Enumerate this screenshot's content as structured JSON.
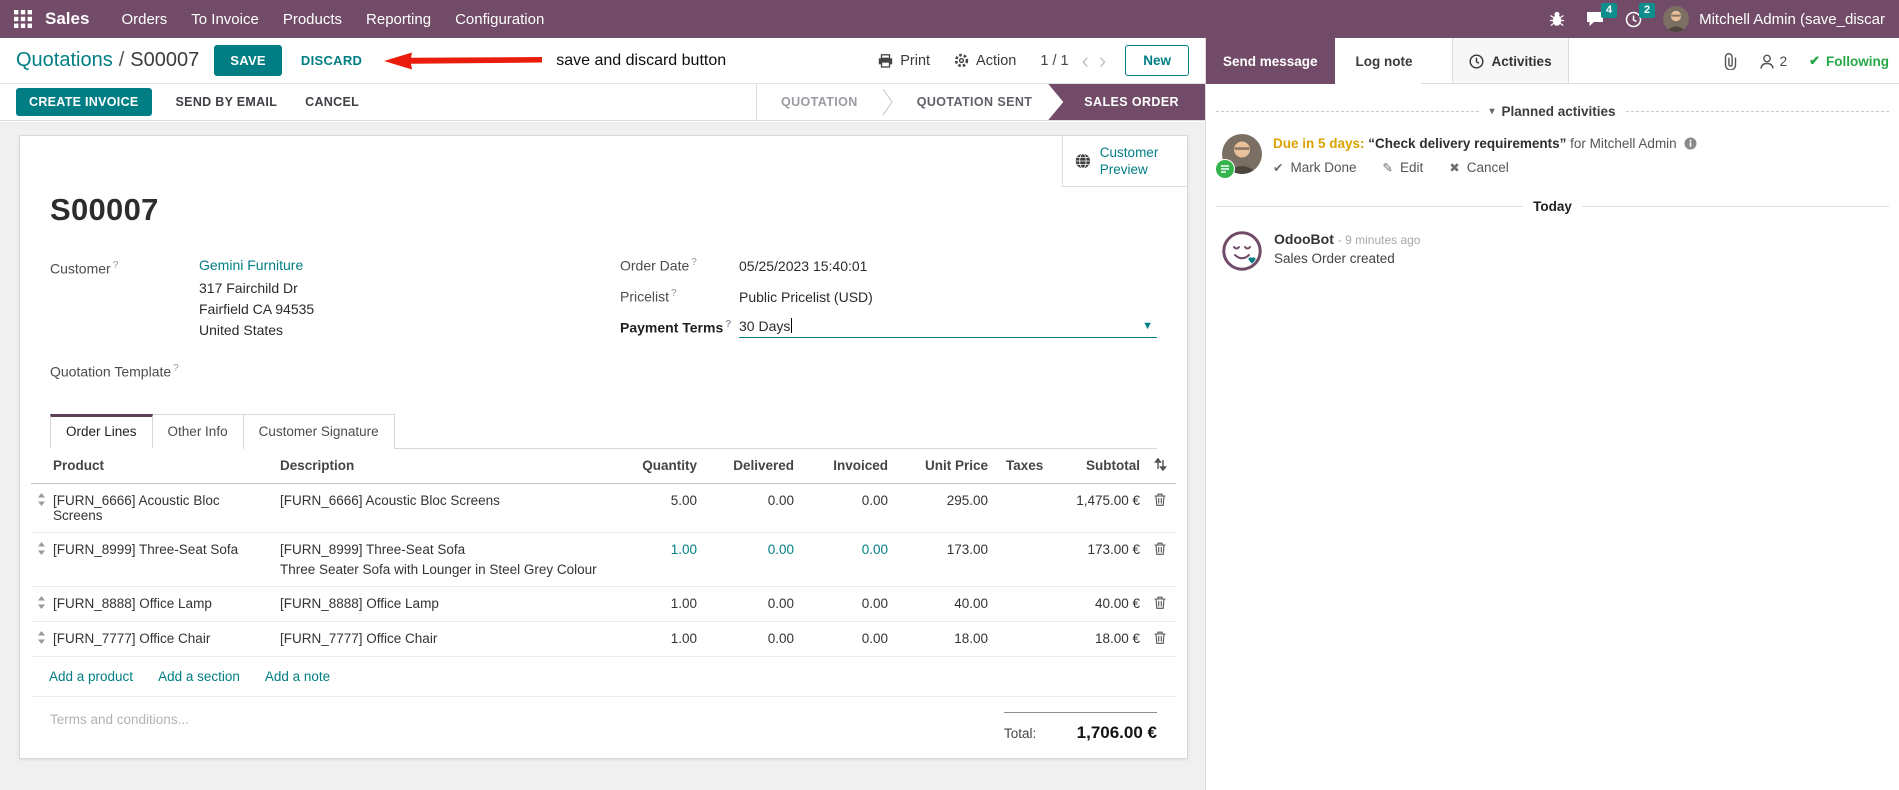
{
  "navbar": {
    "app": "Sales",
    "menus": [
      "Orders",
      "To Invoice",
      "Products",
      "Reporting",
      "Configuration"
    ],
    "badges": {
      "messages": "4",
      "activities": "2"
    },
    "user": "Mitchell Admin (save_discar"
  },
  "control": {
    "breadcrumb_parent": "Quotations",
    "breadcrumb_sep": "/",
    "breadcrumb_current": "S00007",
    "save": "SAVE",
    "discard": "DISCARD",
    "print": "Print",
    "action": "Action",
    "pager": "1 / 1",
    "prev": "‹",
    "next": "›",
    "new": "New"
  },
  "annotation": {
    "text": "save and discard button"
  },
  "actions": {
    "create_invoice": "CREATE INVOICE",
    "send_by_email": "SEND BY EMAIL",
    "cancel": "CANCEL"
  },
  "pipeline": {
    "stages": [
      "QUOTATION",
      "QUOTATION SENT",
      "SALES ORDER"
    ],
    "active": "SALES ORDER"
  },
  "sheet": {
    "customer_preview": "Customer Preview",
    "title": "S00007",
    "fields": {
      "customer_label": "Customer",
      "customer_name": "Gemini Furniture",
      "customer_address": [
        "317 Fairchild Dr",
        "Fairfield CA 94535",
        "United States"
      ],
      "quotation_template_label": "Quotation Template",
      "order_date_label": "Order Date",
      "order_date": "05/25/2023 15:40:01",
      "pricelist_label": "Pricelist",
      "pricelist": "Public Pricelist (USD)",
      "payment_terms_label": "Payment Terms",
      "payment_terms": "30 Days"
    },
    "tabs": [
      "Order Lines",
      "Other Info",
      "Customer Signature"
    ],
    "order_lines": {
      "columns": [
        "Product",
        "Description",
        "Quantity",
        "Delivered",
        "Invoiced",
        "Unit Price",
        "Taxes",
        "Subtotal"
      ],
      "rows": [
        {
          "product": "[FURN_6666] Acoustic Bloc Screens",
          "description": "[FURN_6666] Acoustic Bloc Screens",
          "description2": "",
          "quantity": "5.00",
          "delivered": "0.00",
          "invoiced": "0.00",
          "unit_price": "295.00",
          "taxes": "",
          "subtotal": "1,475.00 €",
          "edited": false
        },
        {
          "product": "[FURN_8999] Three-Seat Sofa",
          "description": "[FURN_8999] Three-Seat Sofa",
          "description2": "Three Seater Sofa with Lounger in Steel Grey Colour",
          "quantity": "1.00",
          "delivered": "0.00",
          "invoiced": "0.00",
          "unit_price": "173.00",
          "taxes": "",
          "subtotal": "173.00 €",
          "edited": true
        },
        {
          "product": "[FURN_8888] Office Lamp",
          "description": "[FURN_8888] Office Lamp",
          "description2": "",
          "quantity": "1.00",
          "delivered": "0.00",
          "invoiced": "0.00",
          "unit_price": "40.00",
          "taxes": "",
          "subtotal": "40.00 €",
          "edited": false
        },
        {
          "product": "[FURN_7777] Office Chair",
          "description": "[FURN_7777] Office Chair",
          "description2": "",
          "quantity": "1.00",
          "delivered": "0.00",
          "invoiced": "0.00",
          "unit_price": "18.00",
          "taxes": "",
          "subtotal": "18.00 €",
          "edited": false
        }
      ],
      "add_links": [
        "Add a product",
        "Add a section",
        "Add a note"
      ]
    },
    "terms_placeholder": "Terms and conditions...",
    "total_label": "Total:",
    "total_value": "1,706.00 €"
  },
  "chatter": {
    "send_message": "Send message",
    "log_note": "Log note",
    "activities": "Activities",
    "followers_count": "2",
    "following_check": "✔",
    "following": "Following",
    "planned_caret": "▾",
    "planned_header": "Planned activities",
    "activity": {
      "due": "Due in 5 days:",
      "summary": "“Check delivery requirements”",
      "for_user": "for Mitchell Admin",
      "mark_done_icon": "✔",
      "mark_done": "Mark Done",
      "edit_icon": "✎",
      "edit": "Edit",
      "cancel_icon": "✖",
      "cancel": "Cancel"
    },
    "today": "Today",
    "message": {
      "author": "OdooBot",
      "time": "- 9 minutes ago",
      "body": "Sales Order created"
    }
  },
  "ui": {
    "help": "?"
  },
  "colors": {
    "brand": "#714B67",
    "primary": "#017e84",
    "badge": "#0e8d8d",
    "success": "#28a745",
    "warning": "#d9a301",
    "danger": "#ea1c0c"
  }
}
